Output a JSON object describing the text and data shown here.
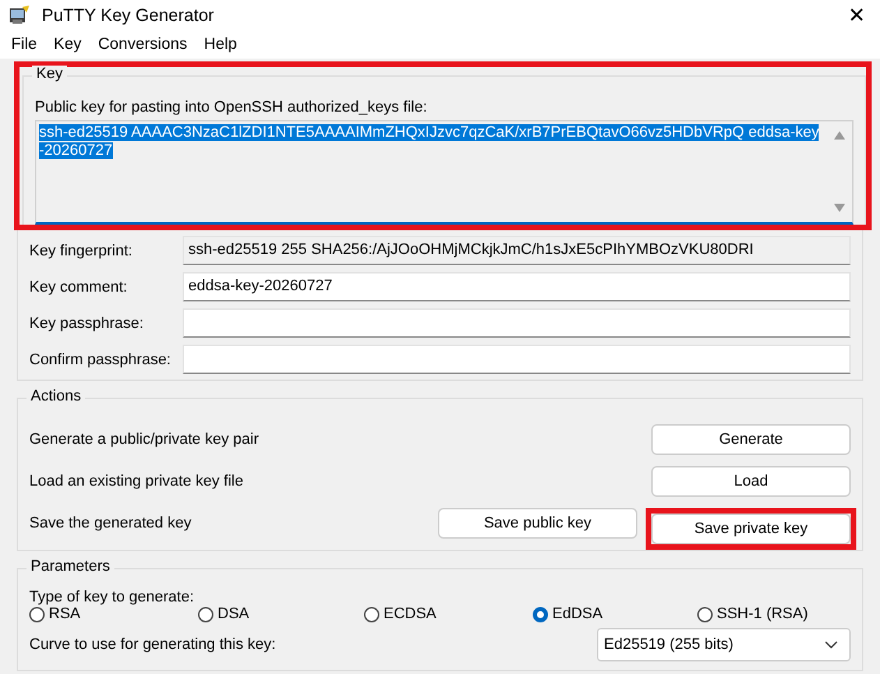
{
  "window": {
    "title": "PuTTY Key Generator",
    "close": "✕"
  },
  "menu": [
    "File",
    "Key",
    "Conversions",
    "Help"
  ],
  "key_group": {
    "title": "Key",
    "highlighted": true,
    "label": "Public key for pasting into OpenSSH authorized_keys file:",
    "public_key": "ssh-ed25519 AAAAC3NzaC1lZDI1NTE5AAAAIMmZHQxIJzvc7qzCaK/xrB7PrEBQtavO66vz5HDbVRpQ eddsa-key-20260727"
  },
  "fields": [
    {
      "label": "Key fingerprint:",
      "value": "ssh-ed25519 255 SHA256:/AjJOoOHMjMCkjkJmC/h1sJxE5cPIhYMBOzVKU80DRI",
      "readonly": true
    },
    {
      "label": "Key comment:",
      "value": "eddsa-key-20260727",
      "readonly": false
    },
    {
      "label": "Key passphrase:",
      "readonly": false
    },
    {
      "label": "Confirm passphrase:",
      "readonly": false
    }
  ],
  "actions": {
    "title": "Actions",
    "rows": [
      {
        "label": "Generate a public/private key pair",
        "buttons": [
          {
            "label": "Generate",
            "highlighted": false
          }
        ]
      },
      {
        "label": "Load an existing private key file",
        "buttons": [
          {
            "label": "Load",
            "highlighted": false
          }
        ]
      },
      {
        "label": "Save the generated key",
        "buttons": [
          {
            "label": "Save public key",
            "highlighted": false
          },
          {
            "label": "Save private key",
            "highlighted": true
          }
        ]
      }
    ]
  },
  "parameters": {
    "title": "Parameters",
    "type_label": "Type of key to generate:",
    "types": [
      {
        "label": "RSA",
        "selected": false
      },
      {
        "label": "DSA",
        "selected": false
      },
      {
        "label": "ECDSA",
        "selected": false
      },
      {
        "label": "EdDSA",
        "selected": true
      },
      {
        "label": "SSH-1 (RSA)",
        "selected": false
      }
    ],
    "curve_label": "Curve to use for generating this key:",
    "curve": "Ed25519 (255 bits)"
  }
}
